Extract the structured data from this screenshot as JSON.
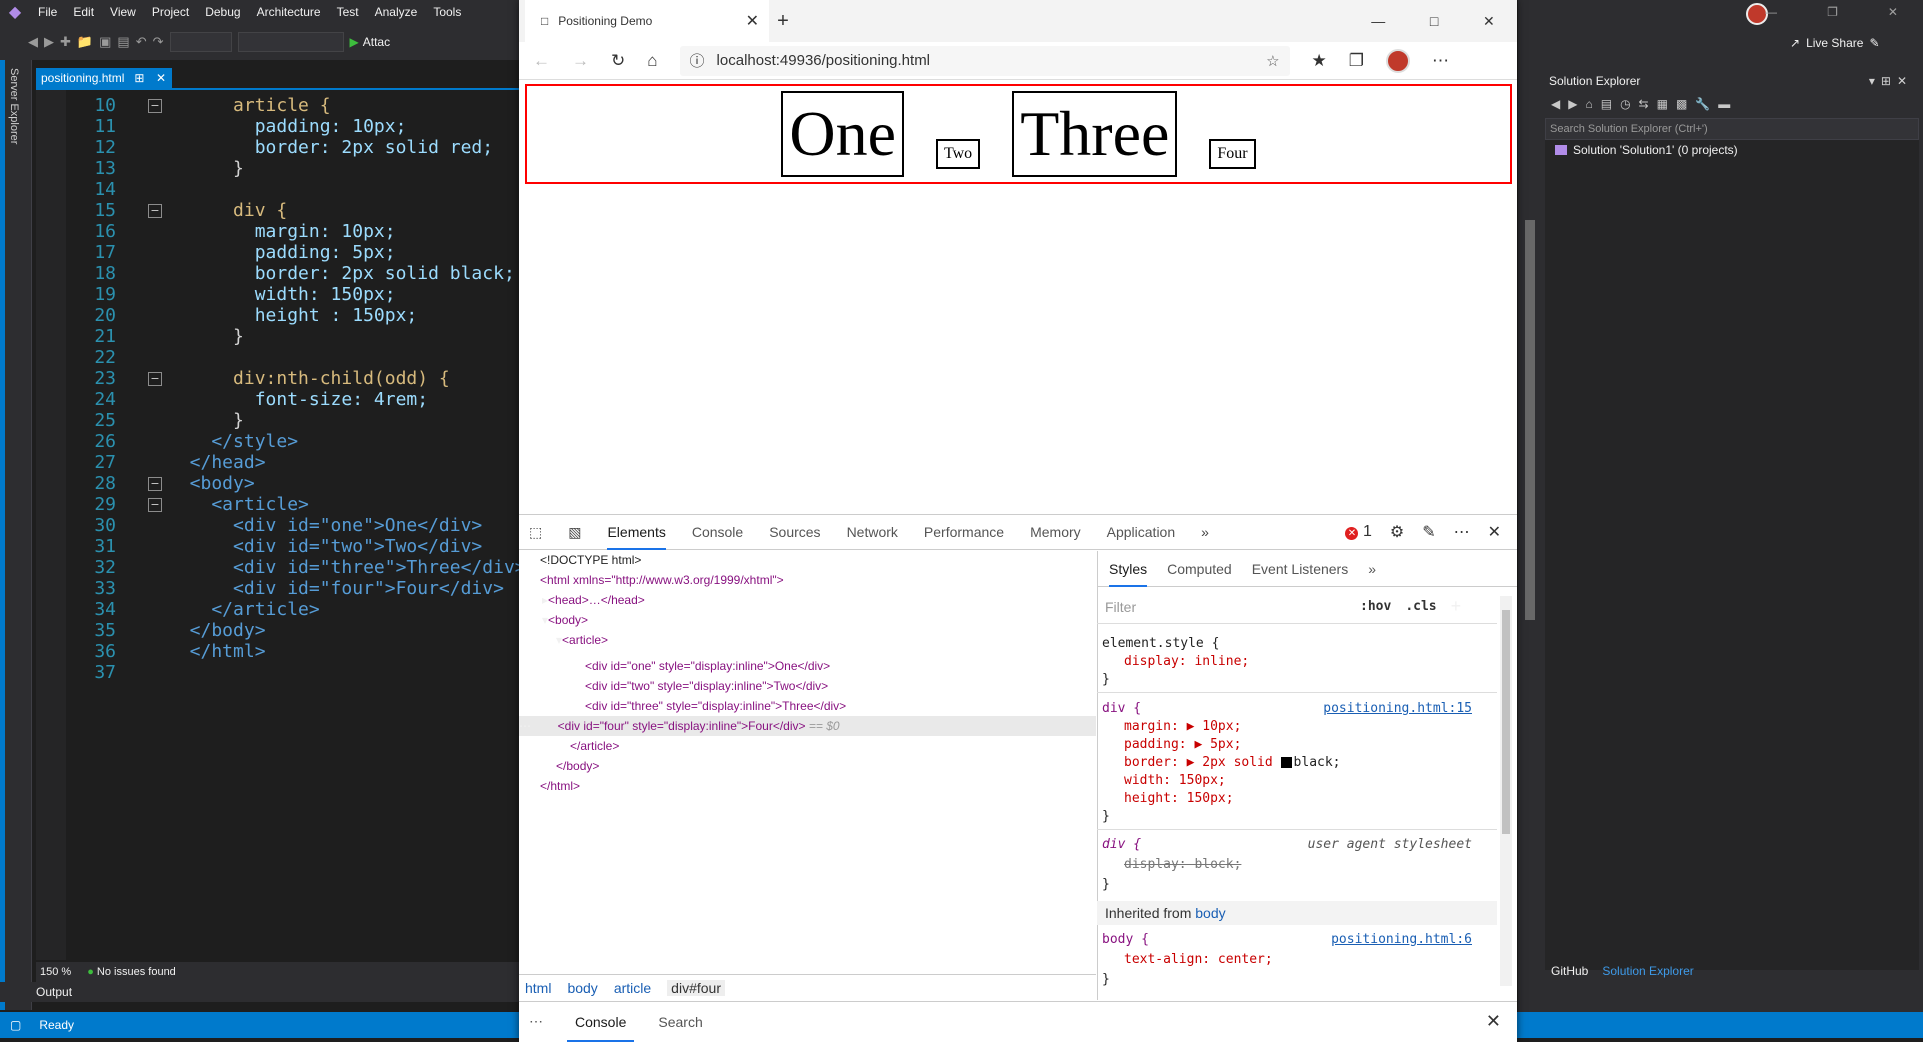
{
  "vs": {
    "menu": [
      "File",
      "Edit",
      "View",
      "Project",
      "Debug",
      "Architecture",
      "Test",
      "Analyze",
      "Tools"
    ],
    "attach_label": "Attac",
    "server_explorer_label": "Server Explorer",
    "editor_tab": "positioning.html",
    "zoom": "150 %",
    "issues": "No issues found",
    "output_label": "Output",
    "status": "Ready",
    "live_share": "Live Share",
    "solution_explorer": {
      "title": "Solution Explorer",
      "search_placeholder": "Search Solution Explorer (Ctrl+')",
      "root": "Solution 'Solution1' (0 projects)",
      "tabs": [
        "GitHub",
        "Solution Explorer"
      ]
    }
  },
  "code_lines": [
    {
      "n": "10",
      "text": "      article {"
    },
    {
      "n": "11",
      "text": "        padding: 10px;"
    },
    {
      "n": "12",
      "text": "        border: 2px solid red;"
    },
    {
      "n": "13",
      "text": "      }"
    },
    {
      "n": "14",
      "text": ""
    },
    {
      "n": "15",
      "text": "      div {"
    },
    {
      "n": "16",
      "text": "        margin: 10px;"
    },
    {
      "n": "17",
      "text": "        padding: 5px;"
    },
    {
      "n": "18",
      "text": "        border: 2px solid black;"
    },
    {
      "n": "19",
      "text": "        width: 150px;"
    },
    {
      "n": "20",
      "text": "        height : 150px;"
    },
    {
      "n": "21",
      "text": "      }"
    },
    {
      "n": "22",
      "text": ""
    },
    {
      "n": "23",
      "text": "      div:nth-child(odd) {"
    },
    {
      "n": "24",
      "text": "        font-size: 4rem;"
    },
    {
      "n": "25",
      "text": "      }"
    },
    {
      "n": "26",
      "text": "    </style>"
    },
    {
      "n": "27",
      "text": "  </head>"
    },
    {
      "n": "28",
      "text": "  <body>"
    },
    {
      "n": "29",
      "text": "    <article>"
    },
    {
      "n": "30",
      "text": "      <div id=\"one\">One</div>"
    },
    {
      "n": "31",
      "text": "      <div id=\"two\">Two</div>"
    },
    {
      "n": "32",
      "text": "      <div id=\"three\">Three</div>"
    },
    {
      "n": "33",
      "text": "      <div id=\"four\">Four</div>"
    },
    {
      "n": "34",
      "text": "    </article>"
    },
    {
      "n": "35",
      "text": "  </body>"
    },
    {
      "n": "36",
      "text": "  </html>"
    },
    {
      "n": "37",
      "text": ""
    }
  ],
  "browser": {
    "tab_title": "Positioning Demo",
    "url": "localhost:49936/positioning.html",
    "demo": [
      "One",
      "Two",
      "Three",
      "Four"
    ]
  },
  "devtools": {
    "tabs": [
      "Elements",
      "Console",
      "Sources",
      "Network",
      "Performance",
      "Memory",
      "Application"
    ],
    "error_count": "1",
    "dom": {
      "doctype": "<!DOCTYPE html>",
      "html_open": "<html xmlns=\"http://www.w3.org/1999/xhtml\">",
      "head": "<head>…</head>",
      "body_open": "<body>",
      "article_open": "<article>",
      "div_one": "<div id=\"one\" style=\"display:inline\">One</div>",
      "div_two": "<div id=\"two\" style=\"display:inline\">Two</div>",
      "div_three": "<div id=\"three\" style=\"display:inline\">Three</div>",
      "div_four": "<div id=\"four\" style=\"display:inline\">Four</div>",
      "div_four_marker": " == $0",
      "article_close": "</article>",
      "body_close": "</body>",
      "html_close": "</html>"
    },
    "breadcrumbs": [
      "html",
      "body",
      "article",
      "div#four"
    ],
    "styles_tabs": [
      "Styles",
      "Computed",
      "Event Listeners"
    ],
    "filter_placeholder": "Filter",
    "hov": ":hov",
    "cls": ".cls",
    "rules": {
      "element_style": "element.style {",
      "display_inline": "display: inline;",
      "div_sel": "div {",
      "div_link": "positioning.html:15",
      "margin": "margin: ▶ 10px;",
      "padding": "padding: ▶ 5px;",
      "border_pre": "border: ▶ 2px solid ",
      "border_post": "black;",
      "width": "width: 150px;",
      "height": "height: 150px;",
      "ua_sel": "div {",
      "ua_label": "user agent stylesheet",
      "ua_display": "display: block;",
      "inherited_label": "Inherited from ",
      "inherited_from": "body",
      "body_sel": "body {",
      "body_link": "positioning.html:6",
      "text_align": "text-align: center;",
      "close": "}"
    },
    "drawer_tabs": [
      "Console",
      "Search"
    ]
  },
  "colors": {
    "accent": "#007acc",
    "devtools_accent": "#1a73e8",
    "article_border": "#ff0000"
  }
}
